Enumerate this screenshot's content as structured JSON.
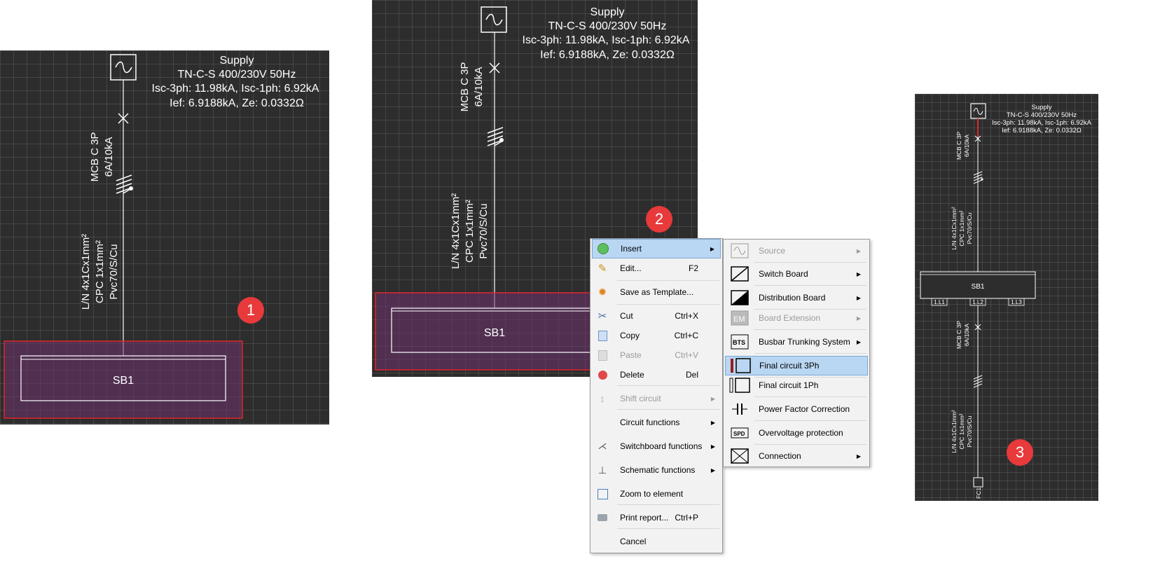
{
  "badges": [
    "1",
    "2",
    "3"
  ],
  "supply": {
    "title": "Supply",
    "system": "TN-C-S 400/230V 50Hz",
    "isc": "Isc-3ph: 11.98kA, Isc-1ph: 6.92kA",
    "ief": "Ief: 6.9188kA, Ze: 0.0332Ω"
  },
  "breaker": {
    "type": "MCB C 3P",
    "rating": "6A/10kA"
  },
  "cable": {
    "line1": "L/N 4x1Cx1mm²",
    "line2": "CPC  1x1mm²",
    "line3": "Pvc70/S/Cu",
    "line3_small": "Pvc70/S/Cu"
  },
  "board": {
    "name": "SB1",
    "phases": [
      "1.L1",
      "1.L2",
      "1.L3"
    ]
  },
  "final_circuit": {
    "name": "FC1"
  },
  "context_menu": {
    "items": [
      {
        "label": "Insert",
        "shortcut": "",
        "submenu": true,
        "disabled": false,
        "highlight": true
      },
      {
        "label": "Edit...",
        "shortcut": "F2",
        "submenu": false,
        "disabled": false
      },
      {
        "label": "Save as Template...",
        "shortcut": "",
        "submenu": false,
        "disabled": false
      },
      {
        "label": "Cut",
        "shortcut": "Ctrl+X",
        "submenu": false,
        "disabled": false
      },
      {
        "label": "Copy",
        "shortcut": "Ctrl+C",
        "submenu": false,
        "disabled": false
      },
      {
        "label": "Paste",
        "shortcut": "Ctrl+V",
        "submenu": false,
        "disabled": true
      },
      {
        "label": "Delete",
        "shortcut": "Del",
        "submenu": false,
        "disabled": false
      },
      {
        "label": "Shift circuit",
        "shortcut": "",
        "submenu": true,
        "disabled": true
      },
      {
        "label": "Circuit functions",
        "shortcut": "",
        "submenu": true,
        "disabled": false
      },
      {
        "label": "Switchboard functions",
        "shortcut": "",
        "submenu": true,
        "disabled": false
      },
      {
        "label": "Schematic functions",
        "shortcut": "",
        "submenu": true,
        "disabled": false
      },
      {
        "label": "Zoom to element",
        "shortcut": "",
        "submenu": false,
        "disabled": false
      },
      {
        "label": "Print report...",
        "shortcut": "Ctrl+P",
        "submenu": false,
        "disabled": false
      },
      {
        "label": "Cancel",
        "shortcut": "",
        "submenu": false,
        "disabled": false
      }
    ]
  },
  "insert_submenu": {
    "items": [
      {
        "label": "Source",
        "icon": "source-icon",
        "submenu": true,
        "disabled": true
      },
      {
        "label": "Switch Board",
        "icon": "switch-board-icon",
        "submenu": true,
        "disabled": false
      },
      {
        "label": "Distribution Board",
        "icon": "distribution-board-icon",
        "submenu": true,
        "disabled": false
      },
      {
        "label": "Board Extension",
        "icon": "board-extension-icon",
        "submenu": true,
        "disabled": true
      },
      {
        "label": "Busbar Trunking System",
        "icon": "busbar-icon",
        "icon_text": "BTS",
        "submenu": true,
        "disabled": false
      },
      {
        "label": "Final circuit 3Ph",
        "icon": "final-circuit-3ph-icon",
        "submenu": false,
        "disabled": false,
        "highlight": true
      },
      {
        "label": "Final circuit 1Ph",
        "icon": "final-circuit-1ph-icon",
        "submenu": false,
        "disabled": false
      },
      {
        "label": "Power Factor Correction",
        "icon": "capacitor-icon",
        "submenu": false,
        "disabled": false
      },
      {
        "label": "Overvoltage protection",
        "icon": "spd-icon",
        "icon_text": "SPD",
        "submenu": false,
        "disabled": false
      },
      {
        "label": "Connection",
        "icon": "connection-icon",
        "submenu": true,
        "disabled": false
      }
    ]
  }
}
